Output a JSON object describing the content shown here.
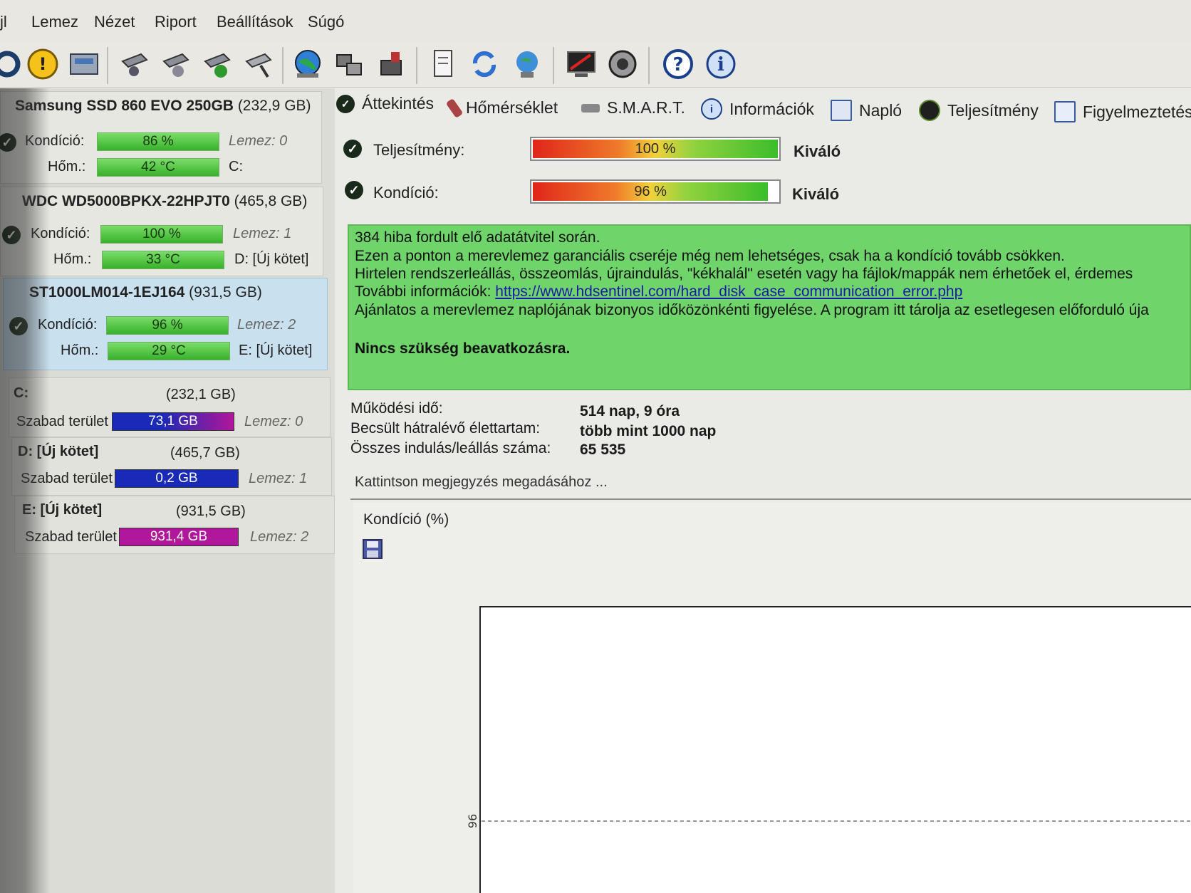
{
  "menu": [
    "jl",
    "Lemez",
    "Nézet",
    "Riport",
    "Beállítások",
    "Súgó"
  ],
  "disks": [
    {
      "name": "Samsung SSD 860 EVO 250GB",
      "capacity": "(232,9 GB)",
      "condition_label": "Kondíció:",
      "condition": "86 %",
      "condition_value": 86,
      "temp_label": "Hőm.:",
      "temp": "42 °C",
      "disk_label": "Lemez: 0",
      "volume": "C:"
    },
    {
      "name": "WDC WD5000BPKX-22HPJT0",
      "capacity": "(465,8 GB)",
      "condition_label": "Kondíció:",
      "condition": "100 %",
      "condition_value": 100,
      "temp_label": "Hőm.:",
      "temp": "33 °C",
      "disk_label": "Lemez: 1",
      "volume": "D: [Új kötet]"
    },
    {
      "name": "ST1000LM014-1EJ164",
      "capacity": "(931,5 GB)",
      "condition_label": "Kondíció:",
      "condition": "96 %",
      "condition_value": 96,
      "temp_label": "Hőm.:",
      "temp": "29 °C",
      "disk_label": "Lemez: 2",
      "volume": "E: [Új kötet]"
    }
  ],
  "volumes": [
    {
      "name": "C:",
      "size": "(232,1 GB)",
      "free_label": "Szabad terület",
      "free": "73,1 GB",
      "disk": "Lemez: 0",
      "bar_color": "#b0179a"
    },
    {
      "name": "D: [Új kötet]",
      "size": "(465,7 GB)",
      "free_label": "Szabad terület",
      "free": "0,2 GB",
      "disk": "Lemez: 1",
      "bar_color": "#1a2ab8"
    },
    {
      "name": "E: [Új kötet]",
      "size": "(931,5 GB)",
      "free_label": "Szabad terület",
      "free": "931,4 GB",
      "disk": "Lemez: 2",
      "bar_color": "#b0179a"
    }
  ],
  "tabs": [
    "Áttekintés",
    "Hőmérséklet",
    "S.M.A.R.T.",
    "Információk",
    "Napló",
    "Teljesítmény",
    "Figyelmeztetés"
  ],
  "overview": {
    "performance_label": "Teljesítmény:",
    "performance": "100 %",
    "performance_value": 100,
    "performance_rating": "Kiváló",
    "condition_label": "Kondíció:",
    "condition": "96 %",
    "condition_value": 96,
    "condition_rating": "Kiváló"
  },
  "message": {
    "line1": "384 hiba fordult elő adatátvitel során.",
    "line2": "Ezen a ponton a merevlemez garanciális cseréje még nem lehetséges, csak ha a kondíció tovább csökken.",
    "line3": "Hirtelen rendszerleállás, összeomlás, újraindulás, \"kékhalál\" esetén vagy ha fájlok/mappák nem érhetőek el, érdemes",
    "line4_prefix": "További információk: ",
    "link": "https://www.hdsentinel.com/hard_disk_case_communication_error.php",
    "line5": "Ajánlatos a merevlemez naplójának bizonyos időközönkénti figyelése. A program itt tárolja az esetlegesen előforduló úja",
    "verdict": "Nincs szükség beavatkozásra."
  },
  "stats": [
    {
      "label": "Működési idő:",
      "value": "514 nap, 9 óra"
    },
    {
      "label": "Becsült hátralévő élettartam:",
      "value": "több mint 1000 nap"
    },
    {
      "label": "Összes indulás/leállás száma:",
      "value": "65 535"
    }
  ],
  "note_placeholder": "Kattintson megjegyzés megadásához ...",
  "chart": {
    "title": "Kondíció  (%)",
    "y_tick": "96"
  },
  "colors": {
    "ok_green": "#6fd46a",
    "selected_disk": "#c9e0ee",
    "link": "#1a1aa8"
  },
  "icons": [
    "refresh-icon",
    "warning-icon",
    "disk-icon",
    "disk-tool-icon",
    "disk-info-icon",
    "disk-check-icon",
    "disk-remove-icon",
    "globe-icon",
    "network-icon",
    "usb-icon",
    "report-icon",
    "sync-icon",
    "monitor-icon",
    "screen-icon",
    "speaker-icon",
    "help-icon",
    "info-icon"
  ]
}
